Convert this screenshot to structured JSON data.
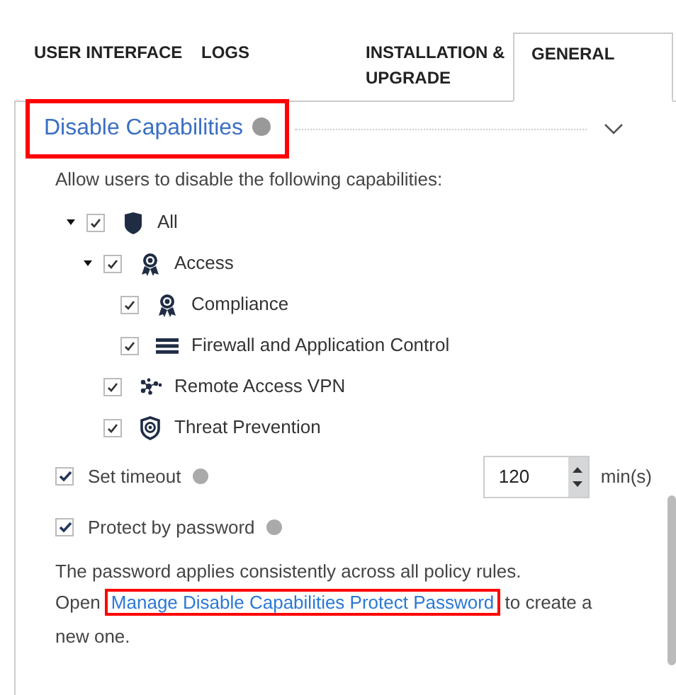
{
  "tabs": [
    {
      "label": "USER INTERFACE",
      "selected": false
    },
    {
      "label": "LOGS",
      "selected": false
    },
    {
      "label": "INSTALLATION & UPGRADE",
      "selected": false
    },
    {
      "label": "GENERAL",
      "selected": true
    }
  ],
  "section": {
    "title": "Disable Capabilities",
    "highlighted": true,
    "expanded": true,
    "description": "Allow users to disable the following capabilities:",
    "tree": [
      {
        "label": "All",
        "checked": true,
        "expanded": true,
        "children": [
          {
            "label": "Access",
            "checked": true,
            "expanded": true,
            "children": [
              {
                "label": "Compliance",
                "checked": true
              },
              {
                "label": "Firewall and Application Control",
                "checked": true
              }
            ]
          },
          {
            "label": "Remote Access VPN",
            "checked": true
          },
          {
            "label": "Threat Prevention",
            "checked": true
          }
        ]
      }
    ],
    "timeout": {
      "label": "Set timeout",
      "checked": true,
      "value": "120",
      "unit": "min(s)"
    },
    "password": {
      "label": "Protect by password",
      "checked": true
    },
    "note_line": "The password applies consistently across all policy rules.",
    "note_before": "Open",
    "link": {
      "text": "Manage Disable Capabilities Protect Password",
      "highlighted": true
    },
    "note_after": "to create a new one."
  }
}
